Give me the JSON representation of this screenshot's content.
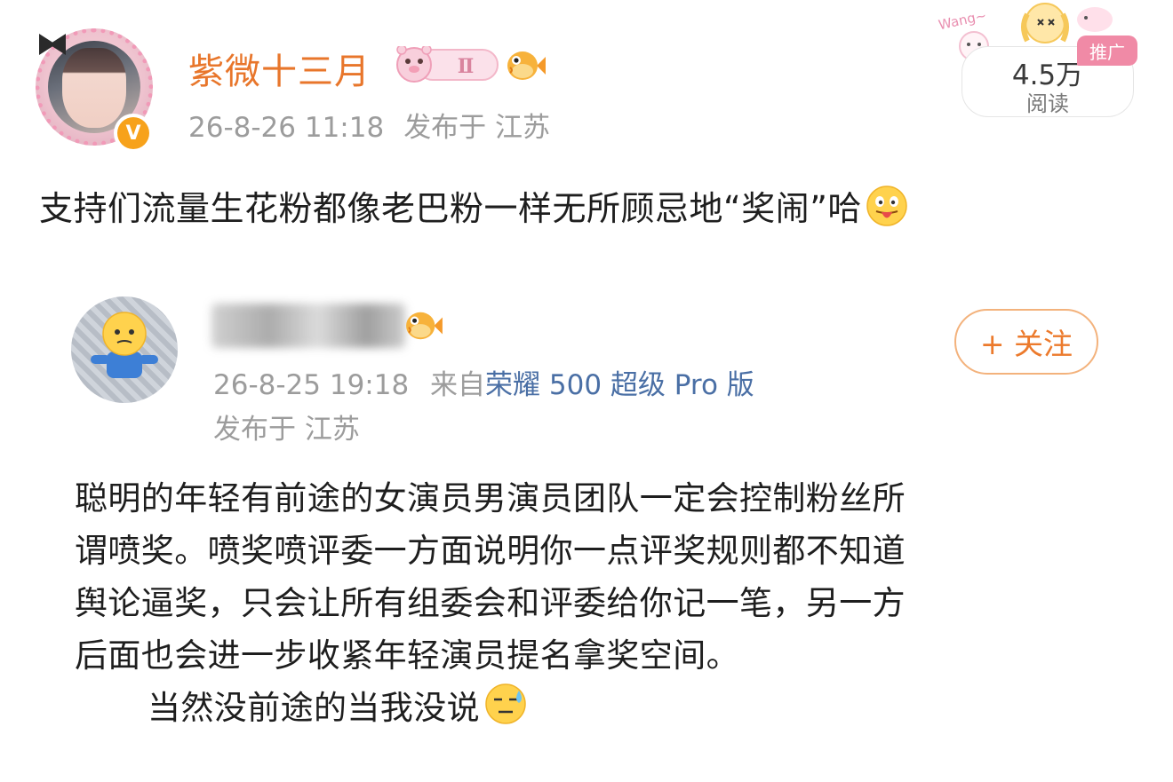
{
  "post": {
    "author": {
      "name": "紫微十三月",
      "level_badge": "Ⅱ",
      "verified_badge": "V"
    },
    "timestamp": "26-8-26 11:18",
    "location": "发布于 江苏",
    "reads": {
      "count": "4.5万",
      "label": "阅读"
    },
    "promo_tag": "推广",
    "sticker_text": "Wang~",
    "text": "支持们流量生花粉都像老巴粉一样无所顾忌地“奖闹”哈"
  },
  "quoted": {
    "timestamp": "26-8-25 19:18",
    "source_prefix": "来自",
    "device": "荣耀 500 超级 Pro 版",
    "location": "发布于 江苏",
    "follow_label": "+ 关注",
    "body_lines": [
      "聪明的年轻有前途的女演员男演员团队一定会控制粉丝所",
      "谓喷奖。喷奖喷评委一方面说明你一点评奖规则都不知道",
      "舆论逼奖，只会让所有组委会和评委给你记一笔，另一方",
      "后面也会进一步收紧年轻演员提名拿奖空间。"
    ],
    "closing_line": "当然没前途的当我没说"
  },
  "colors": {
    "username": "#e8762b",
    "meta_gray": "#9c9c9c",
    "device_link": "#4a6fa5",
    "follow_orange": "#ec7a2c",
    "promo_pink": "#f08aa6",
    "verified_orange": "#f7a21b"
  },
  "icons": {
    "verified": "v-badge-icon",
    "level": "level-badge-icon",
    "fan": "puffer-fish-icon",
    "emoji_tongue": "tongue-out-emoji-icon",
    "emoji_sweat": "sweat-emoji-icon"
  }
}
